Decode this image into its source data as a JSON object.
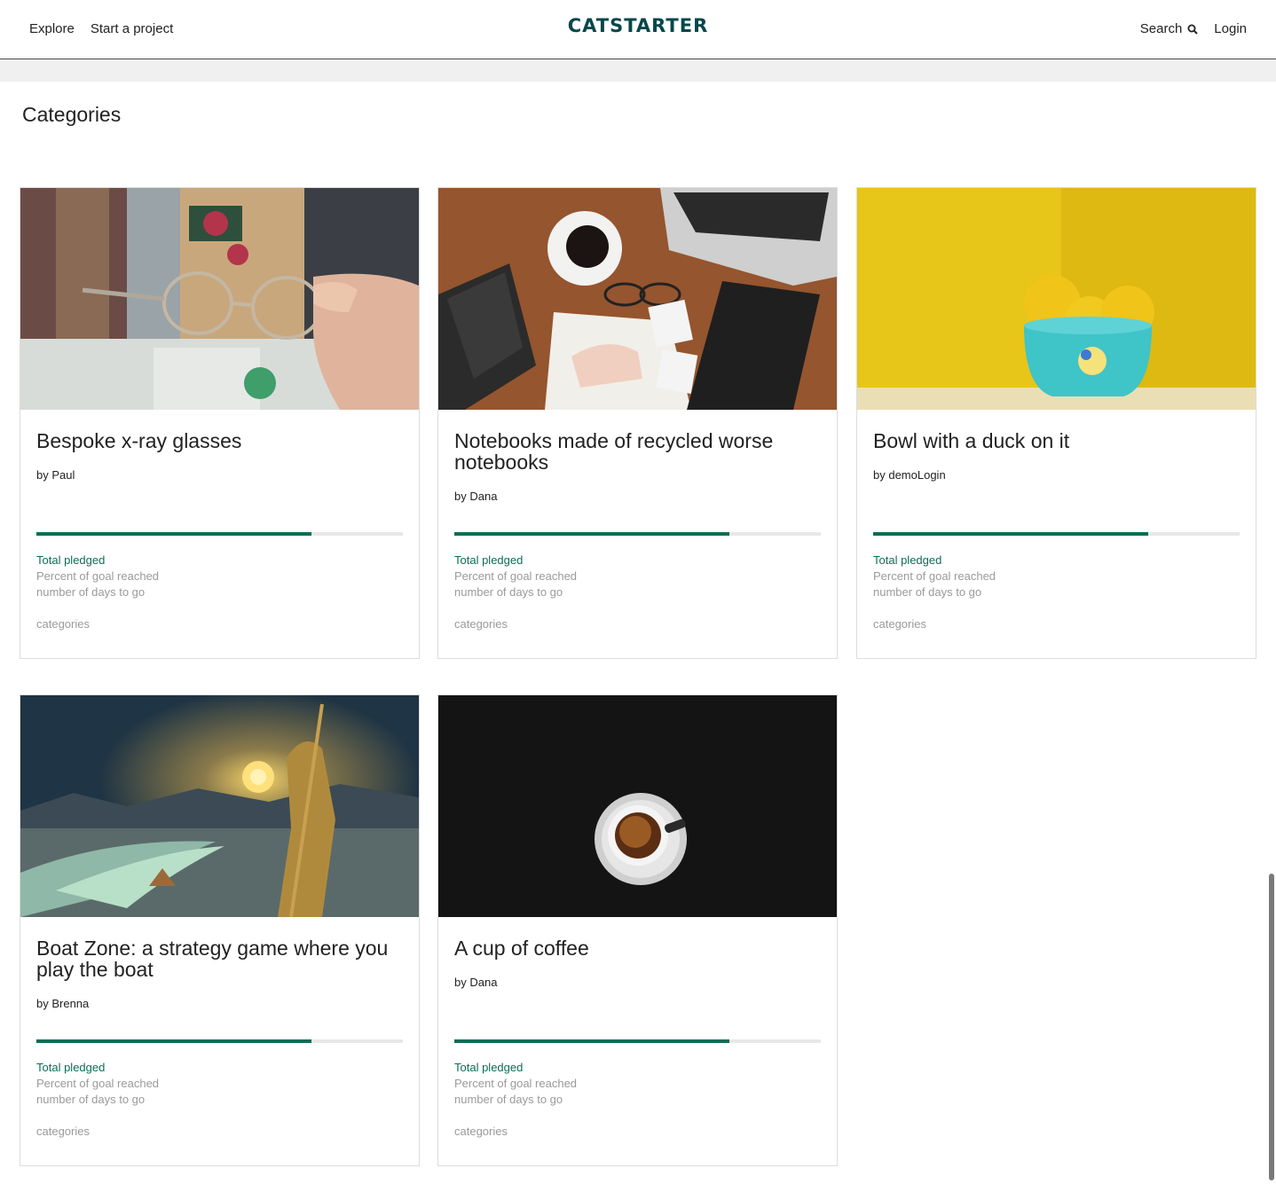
{
  "nav": {
    "explore": "Explore",
    "start_project": "Start a project",
    "logo": "CATSTARTER",
    "search": "Search",
    "login": "Login"
  },
  "page": {
    "heading": "Categories"
  },
  "projects": [
    {
      "title": "Bespoke x-ray glasses",
      "byline": "by Paul",
      "image": "glasses-photo",
      "progress": 0.75,
      "total_pledged": "Total pledged",
      "percent_label": "Percent of goal reached",
      "days_label": "number of days to go",
      "categories": "categories"
    },
    {
      "title": "Notebooks made of recycled worse notebooks",
      "byline": "by Dana",
      "image": "desk-notebook-photo",
      "progress": 0.75,
      "total_pledged": "Total pledged",
      "percent_label": "Percent of goal reached",
      "days_label": "number of days to go",
      "categories": "categories"
    },
    {
      "title": "Bowl with a duck on it",
      "byline": "by demoLogin",
      "image": "lemon-bowl-photo",
      "progress": 0.75,
      "total_pledged": "Total pledged",
      "percent_label": "Percent of goal reached",
      "days_label": "number of days to go",
      "categories": "categories"
    },
    {
      "title": "Boat Zone: a strategy game where you play the boat",
      "byline": "by Brenna",
      "image": "lantern-statue-photo",
      "progress": 0.75,
      "total_pledged": "Total pledged",
      "percent_label": "Percent of goal reached",
      "days_label": "number of days to go",
      "categories": "categories"
    },
    {
      "title": "A cup of coffee",
      "byline": "by Dana",
      "image": "coffee-cup-photo",
      "progress": 0.75,
      "total_pledged": "Total pledged",
      "percent_label": "Percent of goal reached",
      "days_label": "number of days to go",
      "categories": "categories"
    }
  ],
  "colors": {
    "brand": "#06474a",
    "progress": "#0b6e55",
    "muted": "#9a9a9a"
  }
}
